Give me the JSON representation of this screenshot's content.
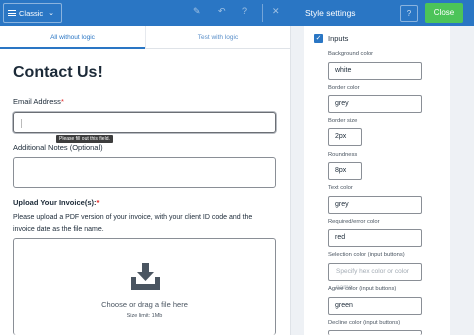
{
  "topbar": {
    "mode_label": "Classic",
    "style_settings_title": "Style settings",
    "help_label": "?",
    "close_label": "Close",
    "accent": "#2a76c4",
    "close_color": "#4cc459"
  },
  "tabs": [
    {
      "label": "All without logic"
    },
    {
      "label": "Test with logic"
    }
  ],
  "form": {
    "title": "Contact Us!",
    "email_label": "Email Address",
    "required_mark": "*",
    "tooltip": "Please fill out this field.",
    "notes_label": "Additional Notes (Optional)",
    "upload_label": "Upload Your Invoice(s):",
    "upload_desc": "Please upload a PDF version of your invoice, with your client ID code and the invoice date as the file name.",
    "upload_text": "Choose or drag a file here",
    "upload_limit": "Size limit: 1Mb"
  },
  "panel": {
    "inputs_label": "Inputs",
    "fields": [
      {
        "label": "Background color",
        "value": "white"
      },
      {
        "label": "Border color",
        "value": "grey"
      },
      {
        "label": "Border size",
        "value": "2px"
      },
      {
        "label": "Roundness",
        "value": "8px"
      },
      {
        "label": "Text color",
        "value": "grey"
      },
      {
        "label": "Required/error color",
        "value": "red"
      },
      {
        "label": "Selection color (input buttons)",
        "placeholder": "Specify hex color or color name"
      },
      {
        "label": "Agree color (input buttons)",
        "value": "green"
      },
      {
        "label": "Decline color (input buttons)",
        "value": ""
      }
    ]
  }
}
